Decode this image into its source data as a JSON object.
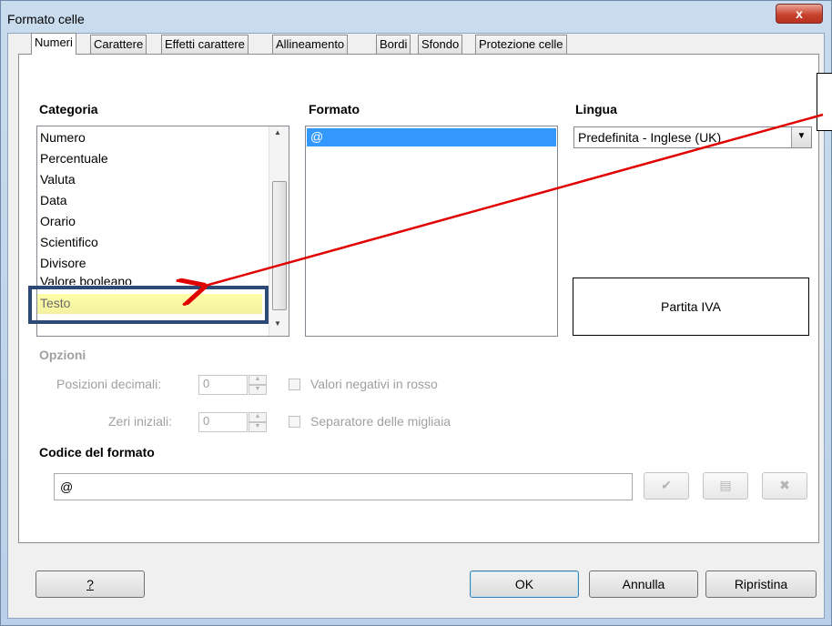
{
  "window": {
    "title": "Formato celle",
    "close_label": "x"
  },
  "tabs": [
    {
      "label": "Numeri",
      "active": true
    },
    {
      "label": "Carattere"
    },
    {
      "label": "Effetti carattere"
    },
    {
      "label": "Allineamento"
    },
    {
      "label": "Bordi"
    },
    {
      "label": "Sfondo"
    },
    {
      "label": "Protezione celle"
    }
  ],
  "category": {
    "label": "Categoria",
    "items": [
      "Numero",
      "Percentuale",
      "Valuta",
      "Data",
      "Orario",
      "Scientifico",
      "Divisore",
      "Valore booleano",
      "Testo"
    ],
    "selected": "Testo"
  },
  "format": {
    "label": "Formato",
    "items": [
      "@"
    ],
    "selected": "@"
  },
  "language": {
    "label": "Lingua",
    "value": "Predefinita - Inglese (UK)"
  },
  "preview": {
    "text": "Partita IVA"
  },
  "options": {
    "label": "Opzioni",
    "decimal_label": "Posizioni decimali:",
    "decimal_value": "0",
    "leading_zeros_label": "Zeri iniziali:",
    "leading_zeros_value": "0",
    "negative_red_label": "Valori negativi in rosso",
    "thousands_sep_label": "Separatore delle migliaia"
  },
  "format_code": {
    "label": "Codice del formato",
    "value": "@"
  },
  "buttons": {
    "help": "?",
    "ok": "OK",
    "cancel": "Annulla",
    "reset": "Ripristina"
  },
  "icons": {
    "accept": "checkmark-icon",
    "comment": "comment-icon",
    "delete": "delete-x-icon"
  },
  "colors": {
    "selection": "#3399ff",
    "annotation_arrow": "#e00000",
    "annotation_box": "#2d4a77",
    "highlight_fill": "#ffffb0"
  }
}
